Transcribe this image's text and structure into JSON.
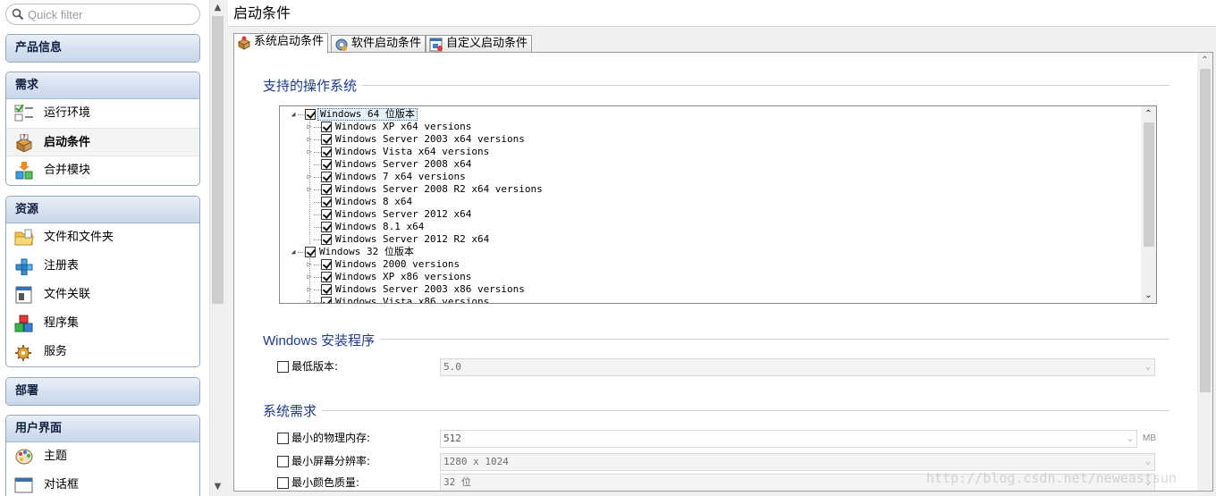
{
  "sidebar": {
    "filter_placeholder": "Quick filter",
    "groups": [
      {
        "title": "产品信息",
        "items": []
      },
      {
        "title": "需求",
        "items": [
          {
            "label": "运行环境",
            "icon": "checklist-icon"
          },
          {
            "label": "启动条件",
            "icon": "launch-conditions-icon",
            "selected": true
          },
          {
            "label": "合并模块",
            "icon": "merge-modules-icon"
          }
        ]
      },
      {
        "title": "资源",
        "items": [
          {
            "label": "文件和文件夹",
            "icon": "folder-icon"
          },
          {
            "label": "注册表",
            "icon": "registry-icon"
          },
          {
            "label": "文件关联",
            "icon": "file-association-icon"
          },
          {
            "label": "程序集",
            "icon": "assemblies-icon"
          },
          {
            "label": "服务",
            "icon": "services-gear-icon"
          }
        ]
      },
      {
        "title": "部署",
        "items": []
      },
      {
        "title": "用户界面",
        "items": [
          {
            "label": "主题",
            "icon": "palette-icon"
          },
          {
            "label": "对话框",
            "icon": "dialog-icon"
          }
        ]
      }
    ]
  },
  "panel": {
    "title": "启动条件",
    "tabs": [
      {
        "label": "系统启动条件",
        "icon": "system-launch-icon",
        "active": true
      },
      {
        "label": "软件启动条件",
        "icon": "software-launch-icon",
        "active": false
      },
      {
        "label": "自定义启动条件",
        "icon": "custom-launch-icon",
        "active": false
      }
    ]
  },
  "os_section": {
    "title": "支持的操作系统",
    "tree": [
      {
        "label": "Windows 64 位版本",
        "level": 0,
        "expander": "open",
        "checked": true,
        "selected": true
      },
      {
        "label": "Windows XP x64 versions",
        "level": 1,
        "expander": "closed",
        "checked": true
      },
      {
        "label": "Windows Server 2003 x64 versions",
        "level": 1,
        "expander": "closed",
        "checked": true
      },
      {
        "label": "Windows Vista x64 versions",
        "level": 1,
        "expander": "closed",
        "checked": true
      },
      {
        "label": "Windows Server 2008 x64",
        "level": 1,
        "expander": "none",
        "checked": true
      },
      {
        "label": "Windows 7 x64 versions",
        "level": 1,
        "expander": "closed",
        "checked": true
      },
      {
        "label": "Windows Server 2008 R2 x64 versions",
        "level": 1,
        "expander": "closed",
        "checked": true
      },
      {
        "label": "Windows 8 x64",
        "level": 1,
        "expander": "none",
        "checked": true
      },
      {
        "label": "Windows Server 2012 x64",
        "level": 1,
        "expander": "none",
        "checked": true
      },
      {
        "label": "Windows 8.1 x64",
        "level": 1,
        "expander": "none",
        "checked": true
      },
      {
        "label": "Windows Server 2012 R2 x64",
        "level": 1,
        "expander": "none",
        "checked": true
      },
      {
        "label": "Windows 32 位版本",
        "level": 0,
        "expander": "open",
        "checked": true
      },
      {
        "label": "Windows 2000 versions",
        "level": 1,
        "expander": "closed",
        "checked": true
      },
      {
        "label": "Windows XP x86 versions",
        "level": 1,
        "expander": "closed",
        "checked": true
      },
      {
        "label": "Windows Server 2003 x86 versions",
        "level": 1,
        "expander": "closed",
        "checked": true
      },
      {
        "label": "Windows Vista x86 versions",
        "level": 1,
        "expander": "closed",
        "checked": true
      }
    ]
  },
  "installer_section": {
    "title": "Windows 安装程序",
    "min_version": {
      "label": "最低版本:",
      "value": "5.0",
      "checked": false
    }
  },
  "requirements_section": {
    "title": "系统需求",
    "rows": [
      {
        "label": "最小的物理内存:",
        "value": "512",
        "unit": "MB",
        "checked": false,
        "disabled": false
      },
      {
        "label": "最小屏幕分辨率:",
        "value": "1280 x 1024",
        "unit": "",
        "checked": false,
        "disabled": true
      },
      {
        "label": "最小颜色质量:",
        "value": "32 位",
        "unit": "",
        "checked": false,
        "disabled": true
      }
    ]
  },
  "watermark": "http://blog.csdn.net/neweastsun",
  "colors": {
    "section_title": "#1e3a8a",
    "group_header_top": "#e9eff7",
    "group_header_bottom": "#c7d6ea"
  }
}
